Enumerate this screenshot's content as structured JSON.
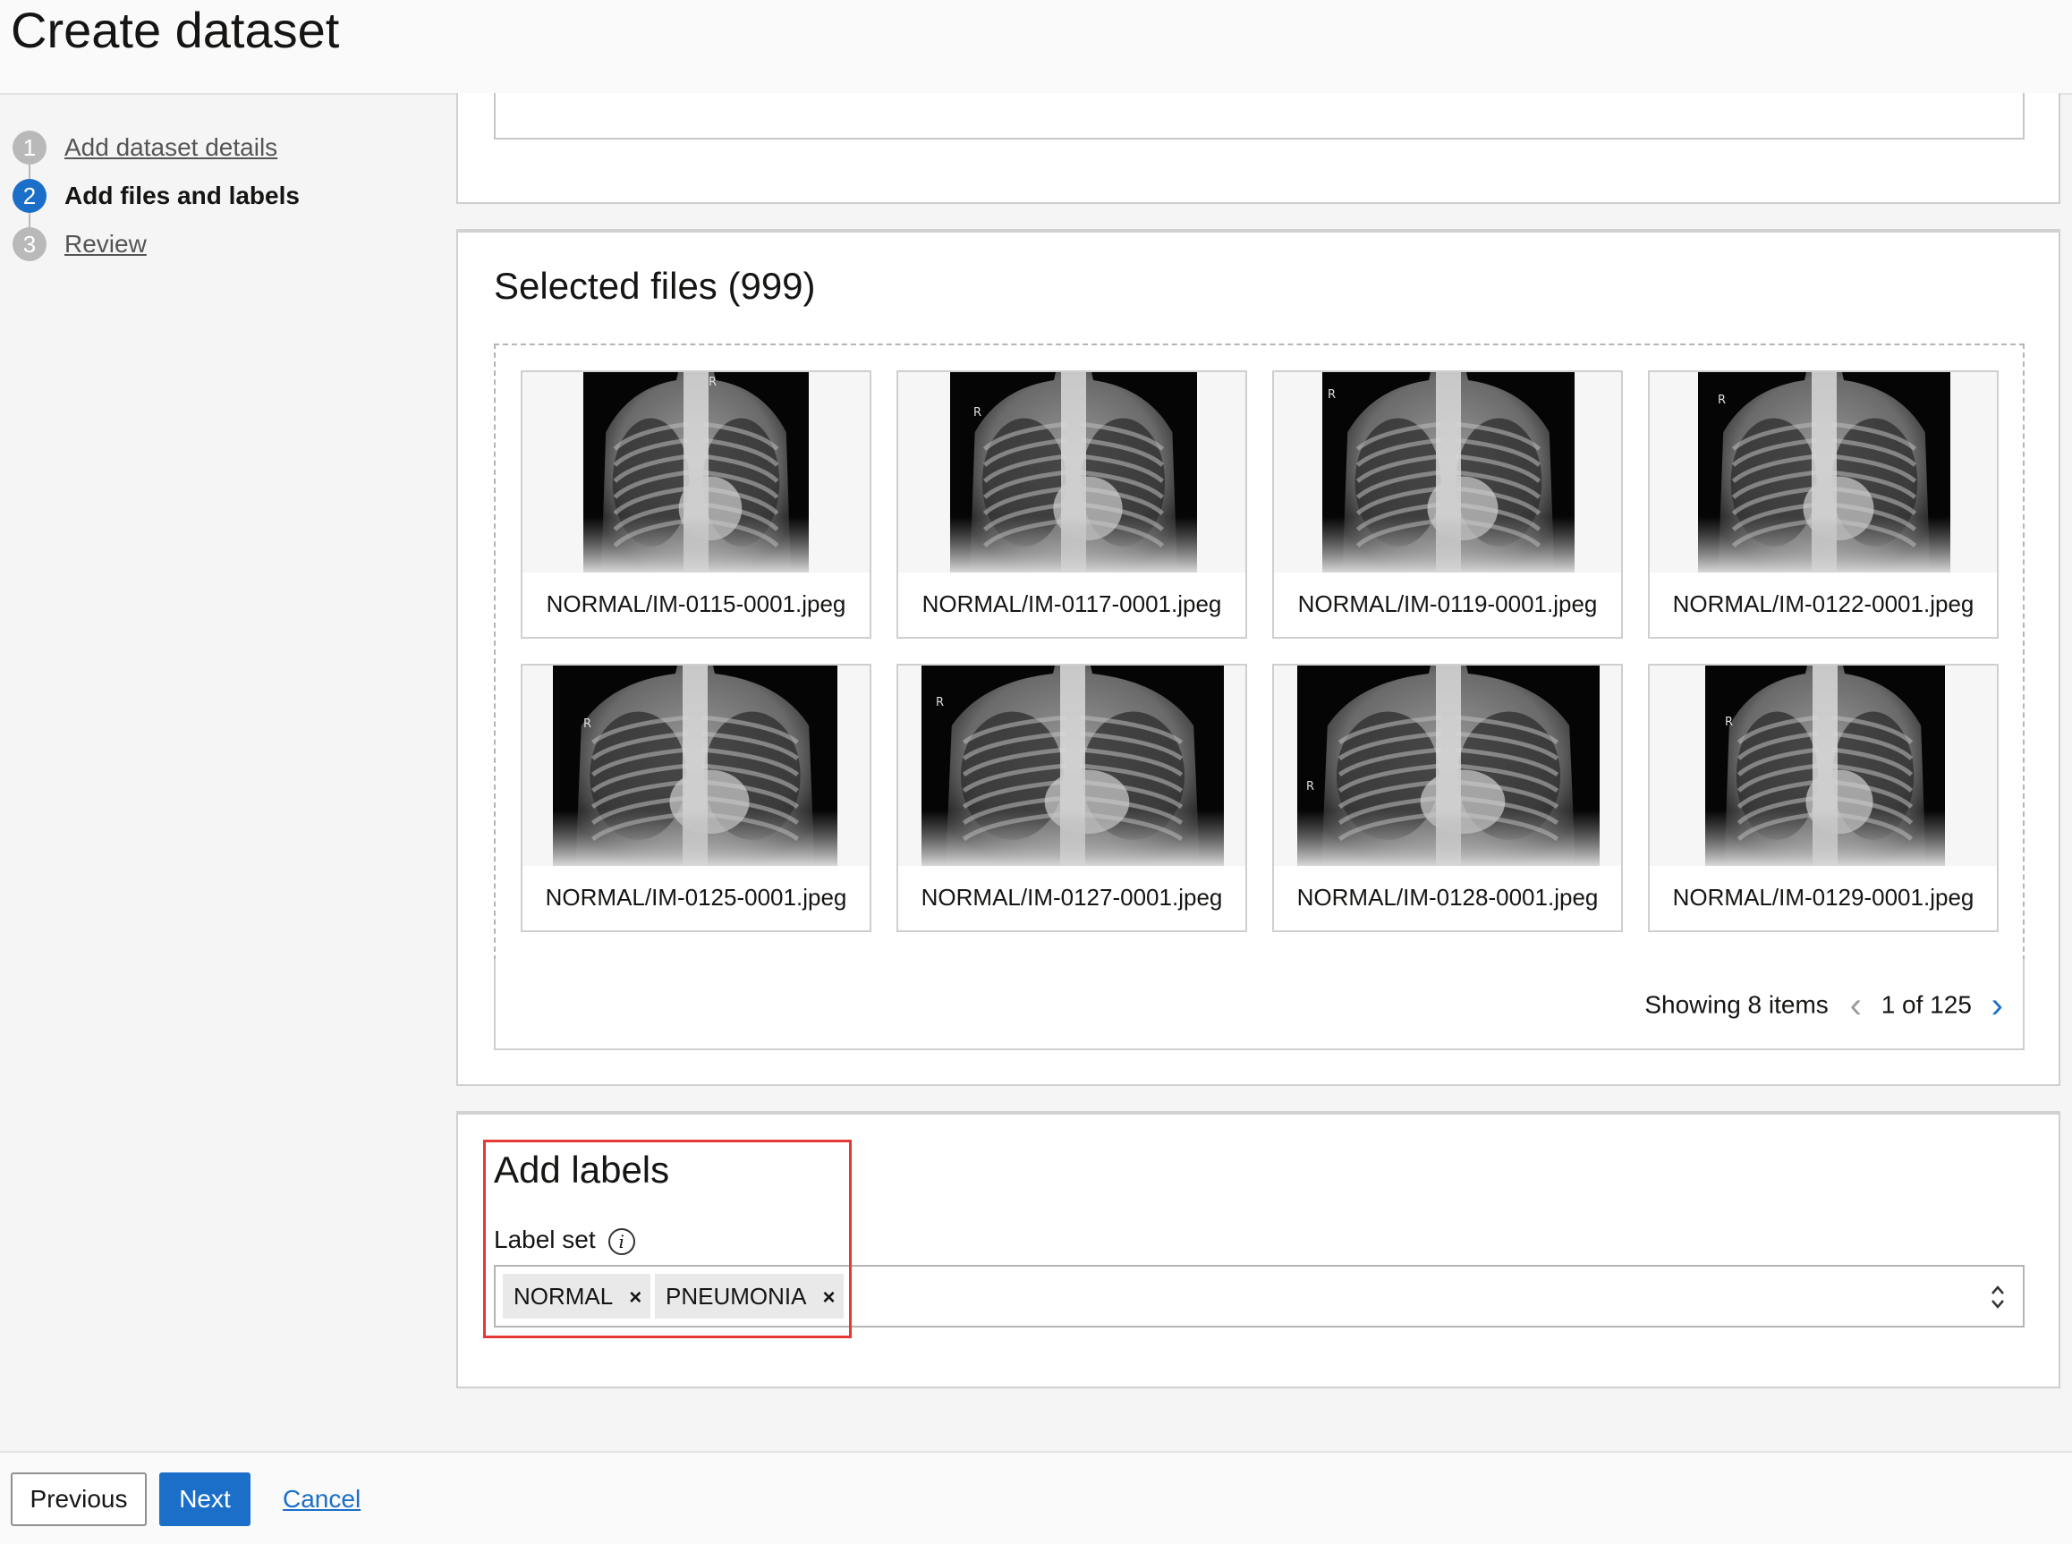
{
  "page": {
    "title": "Create dataset"
  },
  "steps": [
    {
      "number": "1",
      "label": "Add dataset details",
      "state": "link"
    },
    {
      "number": "2",
      "label": "Add files and labels",
      "state": "current"
    },
    {
      "number": "3",
      "label": "Review",
      "state": "link"
    }
  ],
  "selected_files": {
    "title": "Selected files (999)",
    "files": [
      "NORMAL/IM-0115-0001.jpeg",
      "NORMAL/IM-0117-0001.jpeg",
      "NORMAL/IM-0119-0001.jpeg",
      "NORMAL/IM-0122-0001.jpeg",
      "NORMAL/IM-0125-0001.jpeg",
      "NORMAL/IM-0127-0001.jpeg",
      "NORMAL/IM-0128-0001.jpeg",
      "NORMAL/IM-0129-0001.jpeg"
    ],
    "thumbnail_marker": "R",
    "pager": {
      "showing": "Showing 8 items",
      "page": "1 of 125"
    }
  },
  "labels": {
    "title": "Add labels",
    "field_label": "Label set",
    "info_glyph": "i",
    "chips": [
      "NORMAL",
      "PNEUMONIA"
    ],
    "chip_remove_glyph": "×"
  },
  "footer": {
    "previous": "Previous",
    "next": "Next",
    "cancel": "Cancel"
  },
  "colors": {
    "primary": "#1b6fc9",
    "highlight": "#e53935",
    "step_inactive": "#b9b9b9"
  },
  "icons": {
    "info": "info-icon",
    "remove": "close-icon",
    "pager_prev": "chevron-left-icon",
    "pager_next": "chevron-right-icon",
    "select_toggle": "chevron-up-down-icon"
  }
}
